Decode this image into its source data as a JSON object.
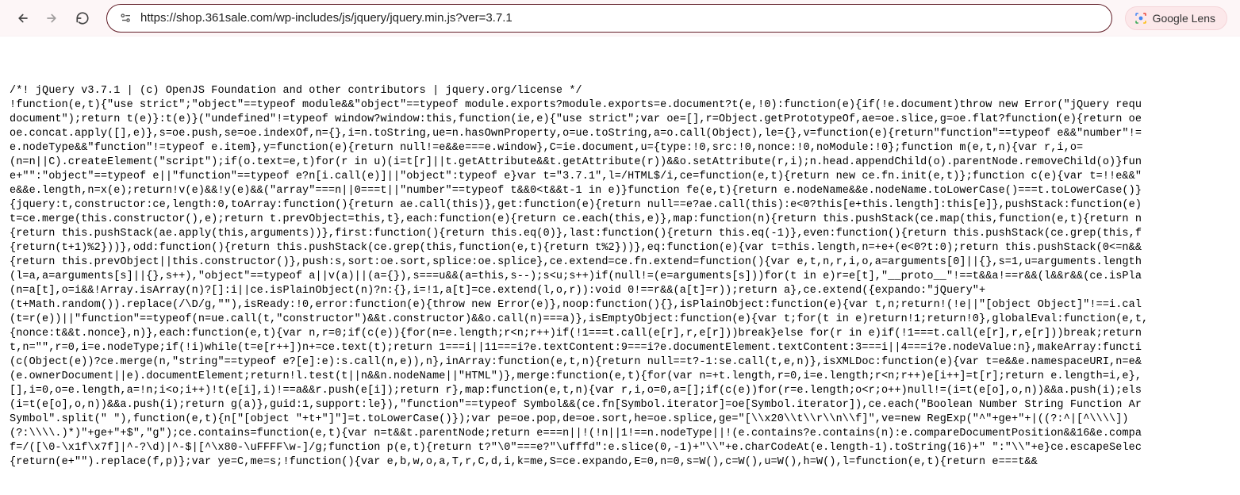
{
  "toolbar": {
    "url": "https://shop.361sale.com/wp-includes/js/jquery/jquery.min.js?ver=3.7.1",
    "google_lens_label": "Google Lens"
  },
  "source_lines": [
    "/*! jQuery v3.7.1 | (c) OpenJS Foundation and other contributors | jquery.org/license */",
    "!function(e,t){\"use strict\";\"object\"==typeof module&&\"object\"==typeof module.exports?module.exports=e.document?t(e,!0):function(e){if(!e.document)throw new Error(\"jQuery requ",
    "document\");return t(e)}:t(e)}(\"undefined\"!=typeof window?window:this,function(ie,e){\"use strict\";var oe=[],r=Object.getPrototypeOf,ae=oe.slice,g=oe.flat?function(e){return oe",
    "oe.concat.apply([],e)},s=oe.push,se=oe.indexOf,n={},i=n.toString,ue=n.hasOwnProperty,o=ue.toString,a=o.call(Object),le={},v=function(e){return\"function\"==typeof e&&\"number\"!=",
    "e.nodeType&&\"function\"!=typeof e.item},y=function(e){return null!=e&&e===e.window},C=ie.document,u={type:!0,src:!0,nonce:!0,noModule:!0};function m(e,t,n){var r,i,o=",
    "(n=n||C).createElement(\"script\");if(o.text=e,t)for(r in u)(i=t[r]||t.getAttribute&&t.getAttribute(r))&&o.setAttribute(r,i);n.head.appendChild(o).parentNode.removeChild(o)}fun",
    "e+\"\":\"object\"==typeof e||\"function\"==typeof e?n[i.call(e)]||\"object\":typeof e}var t=\"3.7.1\",l=/HTML$/i,ce=function(e,t){return new ce.fn.init(e,t)};function c(e){var t=!!e&&\"",
    "e&&e.length,n=x(e);return!v(e)&&!y(e)&&(\"array\"===n||0===t||\"number\"==typeof t&&0<t&&t-1 in e)}function fe(e,t){return e.nodeName&&e.nodeName.toLowerCase()===t.toLowerCase()}",
    "{jquery:t,constructor:ce,length:0,toArray:function(){return ae.call(this)},get:function(e){return null==e?ae.call(this):e<0?this[e+this.length]:this[e]},pushStack:function(e)",
    "t=ce.merge(this.constructor(),e);return t.prevObject=this,t},each:function(e){return ce.each(this,e)},map:function(n){return this.pushStack(ce.map(this,function(e,t){return n",
    "{return this.pushStack(ae.apply(this,arguments))},first:function(){return this.eq(0)},last:function(){return this.eq(-1)},even:function(){return this.pushStack(ce.grep(this,f",
    "{return(t+1)%2}))},odd:function(){return this.pushStack(ce.grep(this,function(e,t){return t%2}))},eq:function(e){var t=this.length,n=+e+(e<0?t:0);return this.pushStack(0<=n&&",
    "{return this.prevObject||this.constructor()},push:s,sort:oe.sort,splice:oe.splice},ce.extend=ce.fn.extend=function(){var e,t,n,r,i,o,a=arguments[0]||{},s=1,u=arguments.length",
    "(l=a,a=arguments[s]||{},s++),\"object\"==typeof a||v(a)||(a={}),s===u&&(a=this,s--);s<u;s++)if(null!=(e=arguments[s]))for(t in e)r=e[t],\"__proto__\"!==t&&a!==r&&(l&&r&&(ce.isPla",
    "(n=a[t],o=i&&!Array.isArray(n)?[]:i||ce.isPlainObject(n)?n:{},i=!1,a[t]=ce.extend(l,o,r)):void 0!==r&&(a[t]=r));return a},ce.extend({expando:\"jQuery\"+",
    "(t+Math.random()).replace(/\\D/g,\"\"),isReady:!0,error:function(e){throw new Error(e)},noop:function(){},isPlainObject:function(e){var t,n;return!(!e||\"[object Object]\"!==i.cal",
    "(t=r(e))||\"function\"==typeof(n=ue.call(t,\"constructor\")&&t.constructor)&&o.call(n)===a)},isEmptyObject:function(e){var t;for(t in e)return!1;return!0},globalEval:function(e,t,",
    "{nonce:t&&t.nonce},n)},each:function(e,t){var n,r=0;if(c(e)){for(n=e.length;r<n;r++)if(!1===t.call(e[r],r,e[r]))break}else for(r in e)if(!1===t.call(e[r],r,e[r]))break;return",
    "t,n=\"\",r=0,i=e.nodeType;if(!i)while(t=e[r++])n+=ce.text(t);return 1===i||11===i?e.textContent:9===i?e.documentElement.textContent:3===i||4===i?e.nodeValue:n},makeArray:functi",
    "(c(Object(e))?ce.merge(n,\"string\"==typeof e?[e]:e):s.call(n,e)),n},inArray:function(e,t,n){return null==t?-1:se.call(t,e,n)},isXMLDoc:function(e){var t=e&&e.namespaceURI,n=e&",
    "(e.ownerDocument||e).documentElement;return!l.test(t||n&&n.nodeName||\"HTML\")},merge:function(e,t){for(var n=+t.length,r=0,i=e.length;r<n;r++)e[i++]=t[r];return e.length=i,e},",
    "[],i=0,o=e.length,a=!n;i<o;i++)!t(e[i],i)!==a&&r.push(e[i]);return r},map:function(e,t,n){var r,i,o=0,a=[];if(c(e))for(r=e.length;o<r;o++)null!=(i=t(e[o],o,n))&&a.push(i);els",
    "(i=t(e[o],o,n))&&a.push(i);return g(a)},guid:1,support:le}),\"function\"==typeof Symbol&&(ce.fn[Symbol.iterator]=oe[Symbol.iterator]),ce.each(\"Boolean Number String Function Ar",
    "Symbol\".split(\" \"),function(e,t){n[\"[object \"+t+\"]\"]=t.toLowerCase()});var pe=oe.pop,de=oe.sort,he=oe.splice,ge=\"[\\\\x20\\\\t\\\\r\\\\n\\\\f]\",ve=new RegExp(\"^\"+ge+\"+|((?:^|[^\\\\\\\\])",
    "(?:\\\\\\\\.)*)\"+ge+\"+$\",\"g\");ce.contains=function(e,t){var n=t&&t.parentNode;return e===n||!(!n||1!==n.nodeType||!(e.contains?e.contains(n):e.compareDocumentPosition&&16&e.compa",
    "f=/([\\0-\\x1f\\x7f]|^-?\\d)|^-$|[^\\x80-\\uFFFF\\w-]/g;function p(e,t){return t?\"\\0\"===e?\"\\ufffd\":e.slice(0,-1)+\"\\\\\"+e.charCodeAt(e.length-1).toString(16)+\" \":\"\\\\\"+e}ce.escapeSelec",
    "{return(e+\"\").replace(f,p)};var ye=C,me=s;!function(){var e,b,w,o,a,T,r,C,d,i,k=me,S=ce.expando,E=0,n=0,s=W(),c=W(),u=W(),h=W(),l=function(e,t){return e===t&&"
  ]
}
